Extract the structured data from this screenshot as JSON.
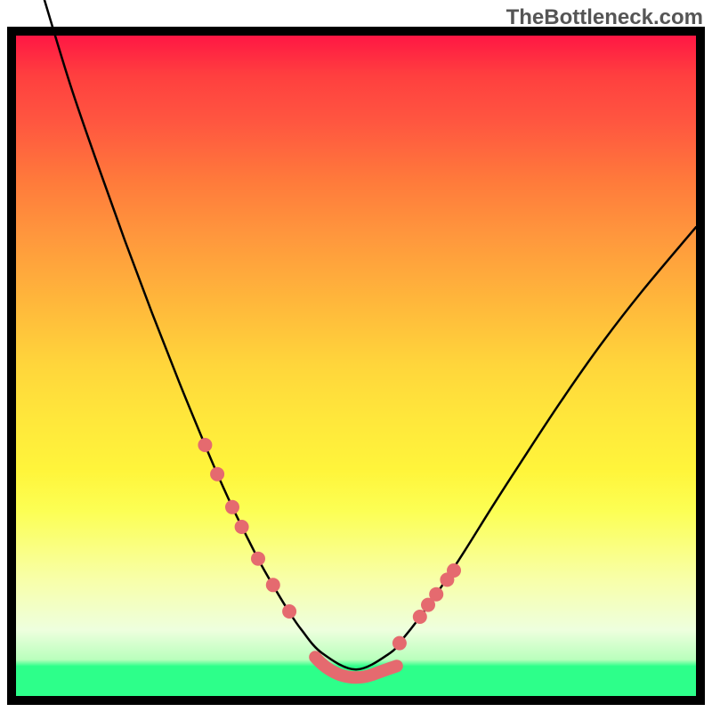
{
  "watermark": "TheBottleneck.com",
  "colors": {
    "frame": "#000000",
    "curve": "#000000",
    "marker": "#e56a6f",
    "gradient_top": "#ff1744",
    "gradient_bottom": "#2dff8a"
  },
  "chart_data": {
    "type": "line",
    "title": "",
    "xlabel": "",
    "ylabel": "",
    "xlim": [
      0,
      1
    ],
    "ylim": [
      0,
      1
    ],
    "note": "Axes are unlabeled in the source image; x and y are normalized 0–1. y is drawn with 0 at the top (higher y = lower on screen). Curve is a smooth V-shaped bottleneck profile with flat bottom near y≈0.96; marker dots highlight points along the curve walls.",
    "series": [
      {
        "name": "curve",
        "x": [
          0.04,
          0.08,
          0.12,
          0.16,
          0.2,
          0.24,
          0.28,
          0.3,
          0.32,
          0.34,
          0.36,
          0.38,
          0.4,
          0.42,
          0.45,
          0.5,
          0.55,
          0.57,
          0.59,
          0.62,
          0.66,
          0.7,
          0.74,
          0.8,
          0.86,
          0.92,
          1.0
        ],
        "y": [
          -0.06,
          0.075,
          0.195,
          0.31,
          0.42,
          0.525,
          0.625,
          0.673,
          0.718,
          0.76,
          0.8,
          0.836,
          0.87,
          0.9,
          0.935,
          0.96,
          0.935,
          0.912,
          0.886,
          0.843,
          0.78,
          0.714,
          0.65,
          0.556,
          0.468,
          0.388,
          0.29
        ]
      }
    ],
    "flat_bottom": {
      "x_start": 0.44,
      "x_end": 0.56,
      "y": 0.96
    },
    "marker_points_left": {
      "x": [
        0.278,
        0.296,
        0.318,
        0.332,
        0.356,
        0.378,
        0.402
      ],
      "y": [
        0.62,
        0.664,
        0.714,
        0.744,
        0.792,
        0.832,
        0.872
      ]
    },
    "marker_points_right": {
      "x": [
        0.564,
        0.594,
        0.606,
        0.618,
        0.634,
        0.644
      ],
      "y": [
        0.92,
        0.88,
        0.862,
        0.846,
        0.824,
        0.81
      ]
    }
  }
}
